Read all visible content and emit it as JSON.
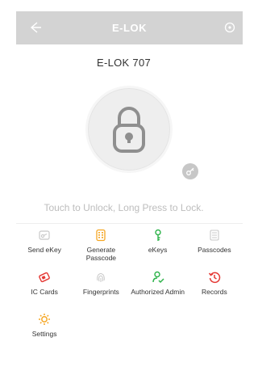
{
  "header": {
    "title": "E-LOK"
  },
  "lock": {
    "name": "E-LOK 707"
  },
  "hint": "Touch to Unlock, Long Press to Lock.",
  "menu": [
    {
      "label": "Send eKey",
      "icon": "send-ekey-icon",
      "color": "#c8c8c8"
    },
    {
      "label": "Generate Passcode",
      "icon": "generate-passcode-icon",
      "color": "#f5a623"
    },
    {
      "label": "eKeys",
      "icon": "ekeys-icon",
      "color": "#2db34a"
    },
    {
      "label": "Passcodes",
      "icon": "passcodes-icon",
      "color": "#c8c8c8"
    },
    {
      "label": "IC Cards",
      "icon": "ic-cards-icon",
      "color": "#e53935"
    },
    {
      "label": "Fingerprints",
      "icon": "fingerprint-icon",
      "color": "#c8c8c8"
    },
    {
      "label": "Authorized Admin",
      "icon": "authorized-admin-icon",
      "color": "#2db34a"
    },
    {
      "label": "Records",
      "icon": "records-icon",
      "color": "#e53935"
    },
    {
      "label": "Settings",
      "icon": "settings-icon",
      "color": "#f5a623"
    }
  ],
  "colors": {
    "header_bg": "#d3d3d3",
    "lock_icon": "#8f8f8f"
  }
}
